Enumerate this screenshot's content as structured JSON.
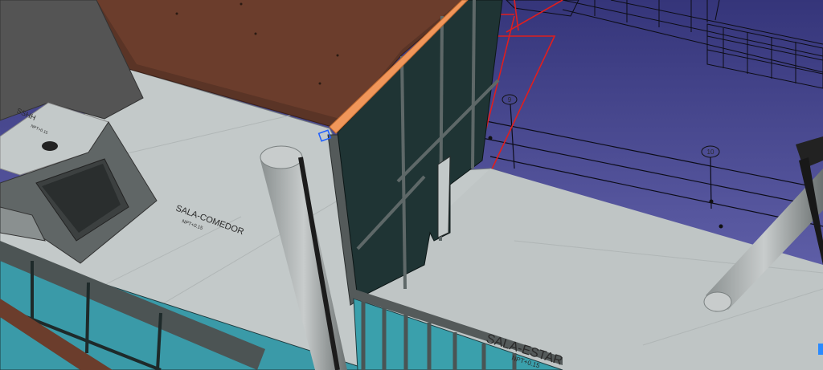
{
  "viewport": {
    "background_top": "#3a3a7a",
    "background_bottom": "#6a6ab0",
    "accent_selected_edge": "#f0965a",
    "section_line_color": "#e01e1e",
    "floor_color": "#c2c8c8",
    "glass_color": "#1f3434",
    "glass_blue_color": "#3a9aa8",
    "wall_color": "#5a3426"
  },
  "rooms": [
    {
      "name": "SALA-COMEDOR",
      "level": "NPT+0.15"
    },
    {
      "name": "SALA-ESTAR",
      "level": "NPT+0.15"
    },
    {
      "name": "SSHH",
      "level": "NPT+0.15"
    }
  ],
  "grid_markers": [
    "9",
    "10"
  ],
  "icons": {
    "selection_marker": "selection-square-icon"
  }
}
